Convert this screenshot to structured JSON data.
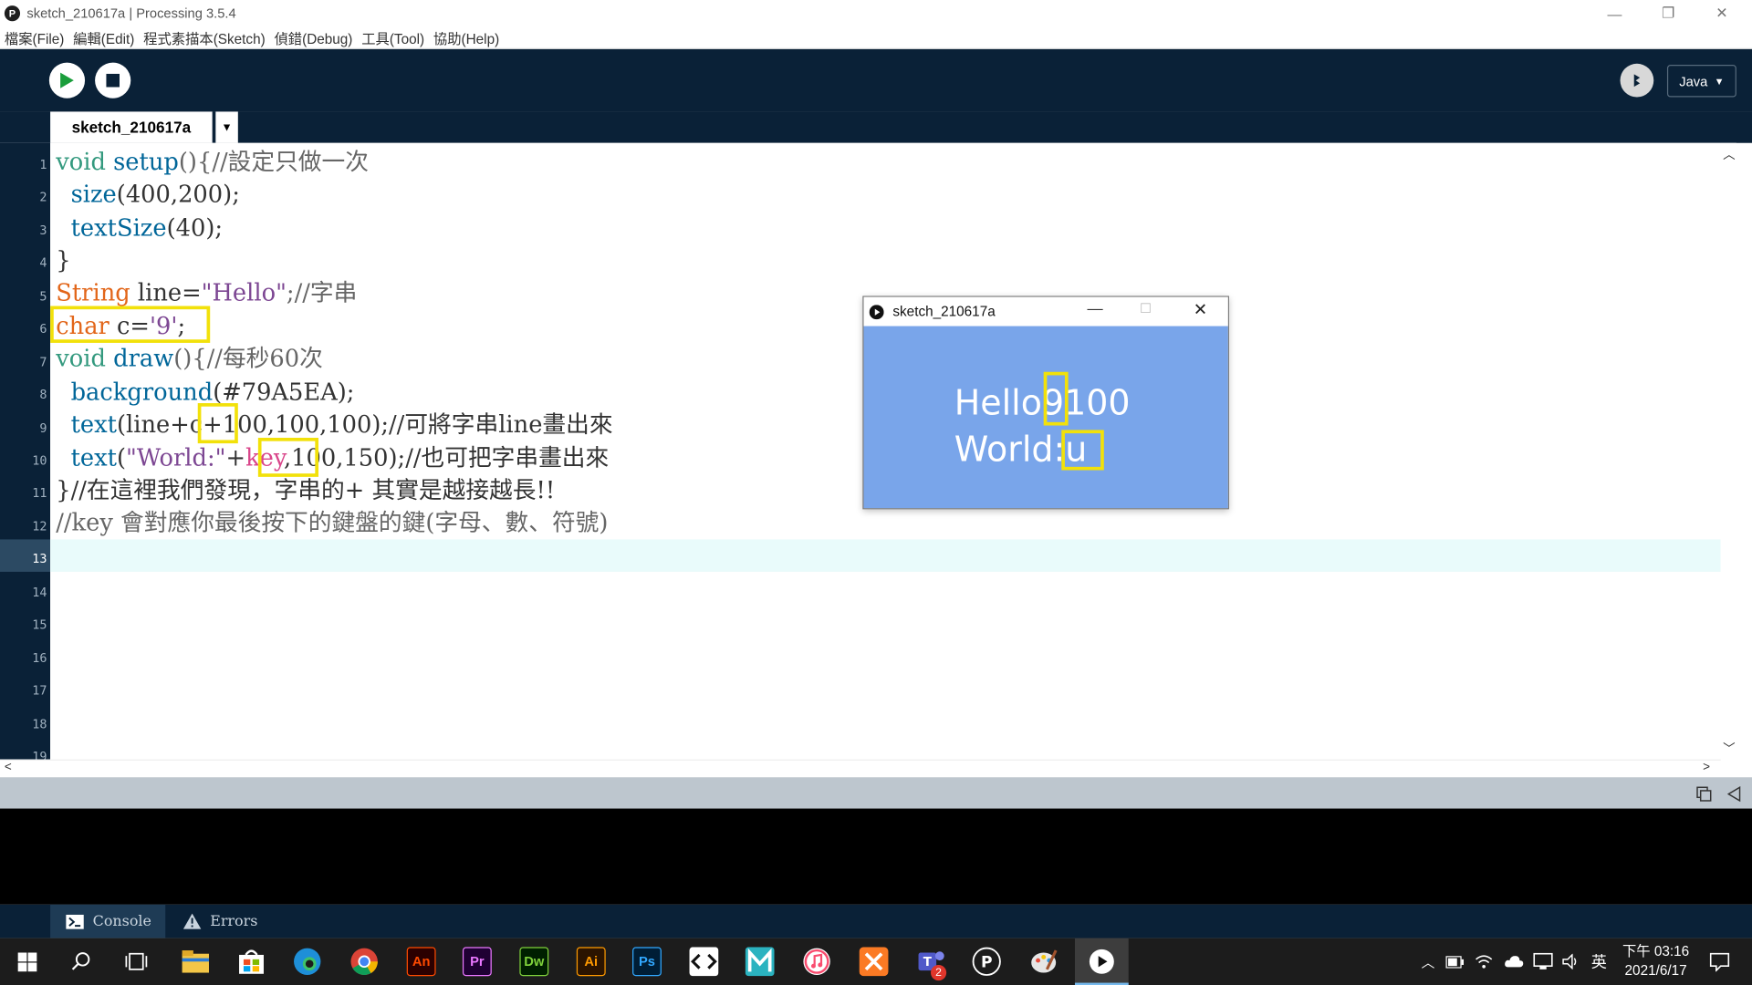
{
  "window": {
    "title": "sketch_210617a | Processing 3.5.4",
    "app_icon": "P",
    "minimize": "—",
    "restore": "❐",
    "close": "✕"
  },
  "menu": [
    "檔案(File)",
    "編輯(Edit)",
    "程式素描本(Sketch)",
    "偵錯(Debug)",
    "工具(Tool)",
    "協助(Help)"
  ],
  "toolbar": {
    "run_icon": "run-triangle",
    "stop_icon": "stop-square",
    "mode_icon_glyph": "ꔪ",
    "mode_label": "Java",
    "mode_arrow": "▼"
  },
  "tab": {
    "label": "sketch_210617a",
    "arrow": "▼"
  },
  "line_numbers": [
    "1",
    "2",
    "3",
    "4",
    "5",
    "6",
    "7",
    "8",
    "9",
    "10",
    "11",
    "12",
    "13",
    "14",
    "15",
    "16",
    "17",
    "18",
    "19"
  ],
  "code": {
    "l1": {
      "a": "void",
      "b": " ",
      "c": "setup",
      "d": "(){//設定只做一次"
    },
    "l2": {
      "a": "  ",
      "b": "size",
      "c": "(400,200);"
    },
    "l3": {
      "a": "  ",
      "b": "textSize",
      "c": "(40);"
    },
    "l4": {
      "a": "}"
    },
    "l5": {
      "a": "String",
      "b": " line=",
      "c": "\"Hello\"",
      "d": ";//字串"
    },
    "l6": {
      "a": "char",
      "b": " c=",
      "c": "'9'",
      "d": ";"
    },
    "l7": {
      "a": "void",
      "b": " ",
      "c": "draw",
      "d": "(){//每秒60次"
    },
    "l8": {
      "a": "  ",
      "b": "background",
      "c": "(#79A5EA);"
    },
    "l9": {
      "a": "  ",
      "b": "text",
      "c": "(line+c+100,100,100);//可將字串line畫出來"
    },
    "l10": {
      "a": "  ",
      "b": "text",
      "c": "(",
      "d": "\"World:\"",
      "e": "+",
      "f": "key",
      "g": ",100,150);//也可把字串畫出來"
    },
    "l11": {
      "a": "}//在這裡我們發現，字串的+ 其實是越接越長!!"
    },
    "l12": {
      "a": "//key 會對應你最後按下的鍵盤的鍵(字母、數、符號)"
    }
  },
  "sketch_window": {
    "title": "sketch_210617a",
    "line1_pre": "Hello",
    "line1_hl": "9",
    "line1_post": "100",
    "line2_pre": "World:",
    "line2_hl": "u"
  },
  "console_tabs": {
    "console": "Console",
    "errors": "Errors"
  },
  "taskbar": {
    "apps": [
      {
        "label": "An",
        "color": "#2b0000",
        "fg": "#ff4a00"
      },
      {
        "label": "Pr",
        "color": "#1f0033",
        "fg": "#ea77ff"
      },
      {
        "label": "Dw",
        "color": "#001f00",
        "fg": "#7fd13b"
      },
      {
        "label": "Ai",
        "color": "#2b1400",
        "fg": "#ff9a00"
      },
      {
        "label": "Ps",
        "color": "#001e36",
        "fg": "#31a8ff"
      }
    ],
    "tray_lang": "英",
    "time": "下午 03:16",
    "date": "2021/6/17",
    "teams_badge": "2"
  },
  "colors": {
    "ide_dark": "#0a2137",
    "sketch_bg": "#79a5ea",
    "highlight_box": "#f2e10a",
    "keyword": "#33997e",
    "type": "#e2661a",
    "function": "#006699",
    "string": "#7d4793"
  }
}
